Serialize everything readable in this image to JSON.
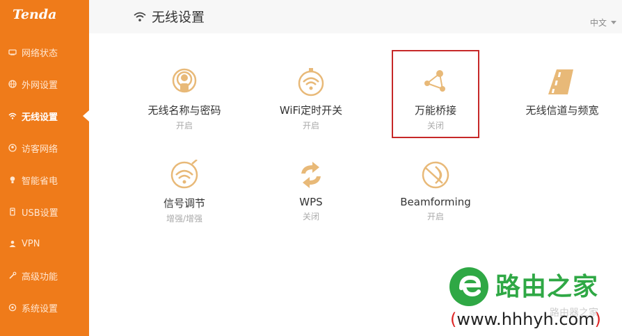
{
  "brand": "Tenda",
  "sidebar": {
    "items": [
      {
        "label": "网络状态",
        "icon": "network-status-icon"
      },
      {
        "label": "外网设置",
        "icon": "globe-icon"
      },
      {
        "label": "无线设置",
        "icon": "wifi-icon",
        "active": true
      },
      {
        "label": "访客网络",
        "icon": "guest-icon"
      },
      {
        "label": "智能省电",
        "icon": "bulb-icon"
      },
      {
        "label": "USB设置",
        "icon": "usb-icon"
      },
      {
        "label": "VPN",
        "icon": "vpn-icon"
      },
      {
        "label": "高级功能",
        "icon": "tools-icon"
      },
      {
        "label": "系统设置",
        "icon": "gear-icon"
      }
    ]
  },
  "header": {
    "title": "无线设置",
    "language": "中文"
  },
  "tiles": [
    {
      "label": "无线名称与密码",
      "status": "开启"
    },
    {
      "label": "WiFi定时开关",
      "status": "开启"
    },
    {
      "label": "万能桥接",
      "status": "关闭"
    },
    {
      "label": "无线信道与频宽",
      "status": ""
    },
    {
      "label": "信号调节",
      "status": "增强/增强"
    },
    {
      "label": "WPS",
      "status": "关闭"
    },
    {
      "label": "Beamforming",
      "status": "开启"
    }
  ],
  "watermark": {
    "title": "路由之家",
    "url_open": "(",
    "url": "www.hhhyh.com",
    "url_close": ")",
    "faint": "路由器之家"
  },
  "colors": {
    "accent": "#ef7b1a",
    "icon": "#e8b978",
    "highlight": "#c62828",
    "watermark_green": "#2fa845"
  }
}
